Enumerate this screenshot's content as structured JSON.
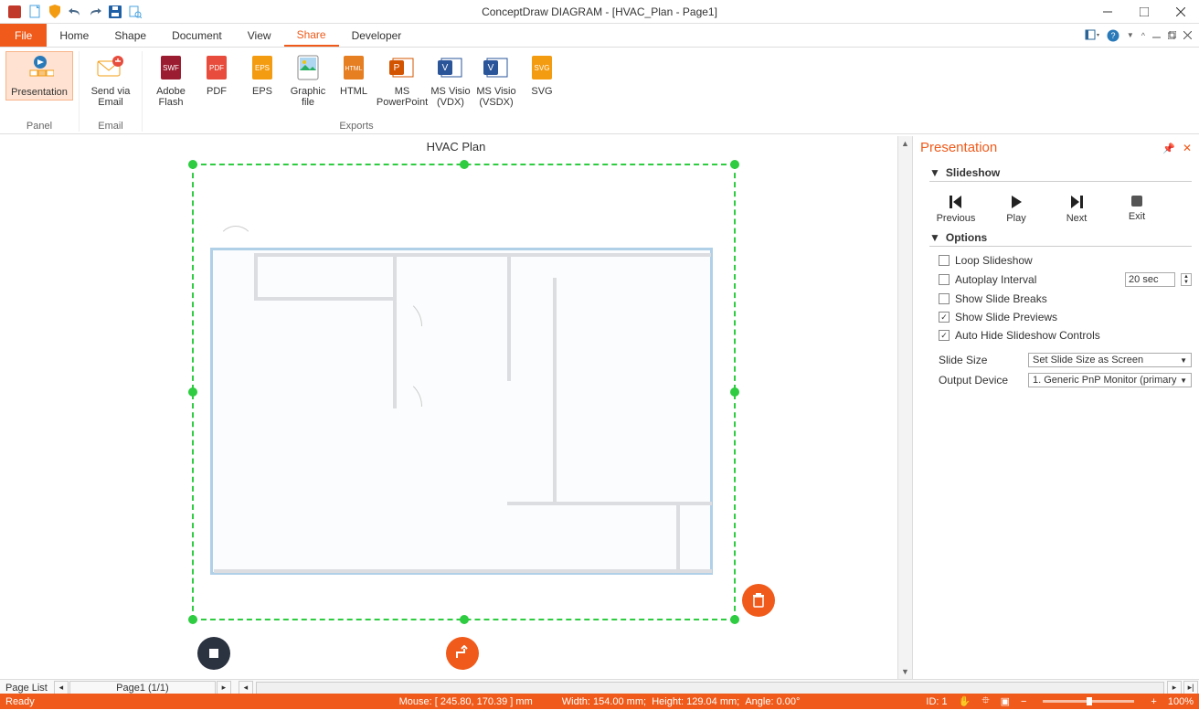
{
  "title": "ConceptDraw DIAGRAM - [HVAC_Plan - Page1]",
  "tabs": {
    "file": "File",
    "list": [
      "Home",
      "Shape",
      "Document",
      "View",
      "Share",
      "Developer"
    ],
    "active": "Share"
  },
  "ribbon": {
    "presentation": {
      "label": "Presentation",
      "group": "Panel"
    },
    "email": {
      "label": "Send via Email",
      "group": "Email"
    },
    "exports_group": "Exports",
    "exports": {
      "flash": "Adobe Flash",
      "pdf": "PDF",
      "eps": "EPS",
      "graphic": "Graphic file",
      "html": "HTML",
      "ppt": "MS PowerPoint",
      "vdx": "MS Visio (VDX)",
      "vsdx": "MS Visio (VSDX)",
      "svg": "SVG"
    }
  },
  "page": {
    "title": "HVAC Plan"
  },
  "pagelist": {
    "label": "Page List",
    "current": "Page1 (1/1)"
  },
  "panel": {
    "title": "Presentation",
    "slideshow_hdr": "Slideshow",
    "btns": {
      "prev": "Previous",
      "play": "Play",
      "next": "Next",
      "exit": "Exit"
    },
    "options_hdr": "Options",
    "loop": "Loop Slideshow",
    "autoplay": "Autoplay Interval",
    "autoplay_value": "20",
    "autoplay_unit": "sec",
    "breaks": "Show Slide Breaks",
    "previews": "Show Slide Previews",
    "autohide": "Auto Hide Slideshow Controls",
    "slidesize_lbl": "Slide Size",
    "slidesize_val": "Set Slide Size as Screen",
    "output_lbl": "Output Device",
    "output_val": "1. Generic PnP Monitor (primary"
  },
  "status": {
    "ready": "Ready",
    "mouse": "Mouse: [ 245.80, 170.39 ] mm",
    "width": "Width: 154.00 mm;",
    "height": "Height: 129.04 mm;",
    "angle": "Angle: 0.00°",
    "id": "ID: 1",
    "zoom": "100%"
  }
}
